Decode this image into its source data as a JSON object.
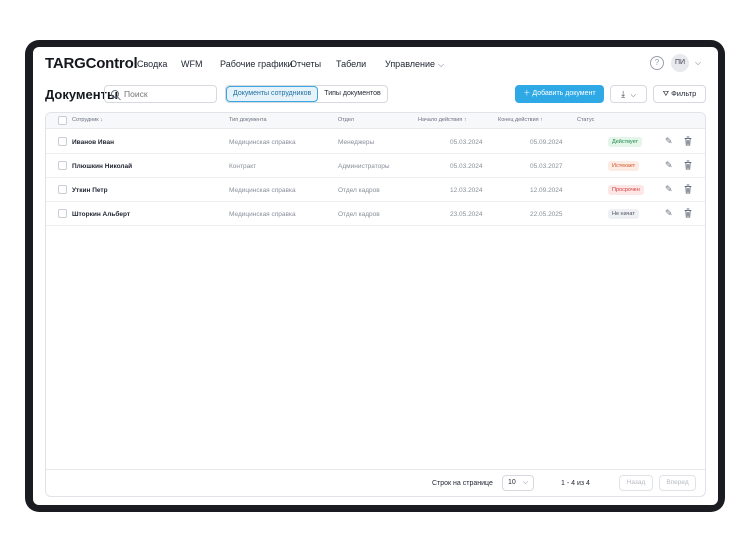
{
  "app": {
    "logo": "TARGControl"
  },
  "nav": {
    "items": [
      "Сводка",
      "WFM",
      "Рабочие графики",
      "Отчеты",
      "Табели",
      "Управление"
    ],
    "help_glyph": "?",
    "avatar_initials": "ПИ"
  },
  "page": {
    "title": "Документы"
  },
  "toolbar": {
    "search_placeholder": "Поиск",
    "segments": [
      "Документы сотрудников",
      "Типы документов"
    ],
    "active_segment": "Документы сотрудников",
    "add_button": "Добавить документ",
    "filter_button": "Фильтр"
  },
  "table": {
    "columns": [
      "Сотрудник ↓",
      "Тип документа",
      "Отдел",
      "Начало действия ↑",
      "Конец действия ↑",
      "Статус"
    ],
    "rows": [
      {
        "employee": "Иванов Иван",
        "doc_type": "Медицинская справка",
        "department": "Менеджеры",
        "start": "05.03.2024",
        "end": "05.09.2024",
        "status": "Действует",
        "status_color": "#1f8a4c",
        "status_bg": "#e4f5ea"
      },
      {
        "employee": "Плюшкин Николай",
        "doc_type": "Контракт",
        "department": "Администраторы",
        "start": "05.03.2024",
        "end": "05.03.2027",
        "status": "Истекает",
        "status_color": "#d0532a",
        "status_bg": "#fdece4"
      },
      {
        "employee": "Уткин Петр",
        "doc_type": "Медицинская справка",
        "department": "Отдел кадров",
        "start": "12.03.2024",
        "end": "12.09.2024",
        "status": "Просрочен",
        "status_color": "#d23a3a",
        "status_bg": "#fde6e6"
      },
      {
        "employee": "Шторкин Альберт",
        "doc_type": "Медицинская справка",
        "department": "Отдел кадров",
        "start": "23.05.2024",
        "end": "22.05.2025",
        "status": "Не начат",
        "status_color": "#4a505c",
        "status_bg": "#eef0f3"
      }
    ]
  },
  "pagination": {
    "rows_per_page_label": "Строк на странице",
    "rows_per_page": "10",
    "range": "1 - 4 из 4",
    "prev": "Назад",
    "next": "Вперед"
  },
  "colors": {
    "accent": "#2fa9e6",
    "frame": "#1b1c22"
  }
}
